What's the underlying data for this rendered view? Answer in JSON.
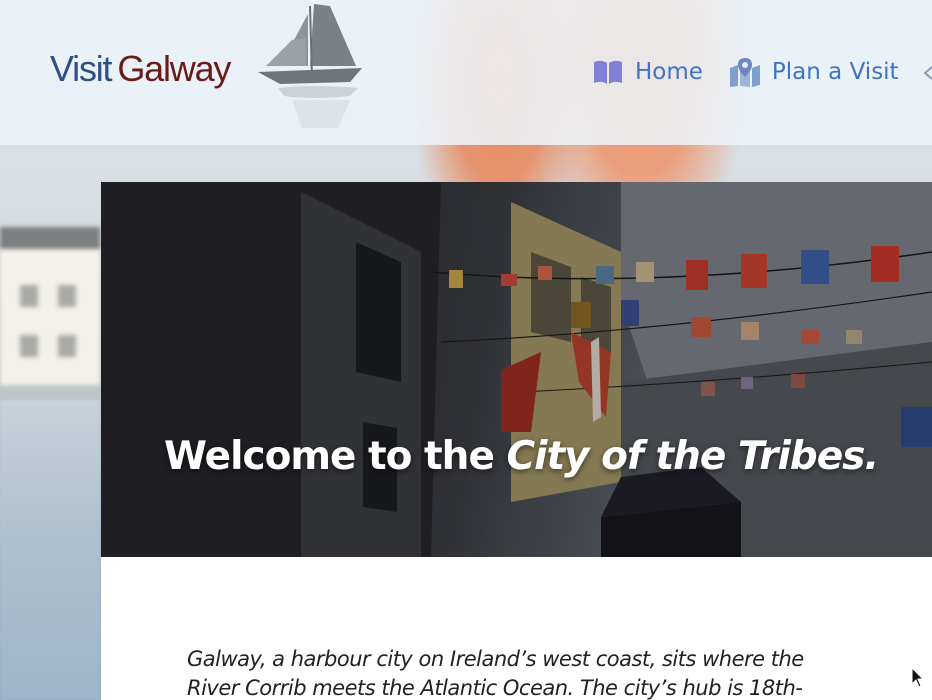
{
  "logo": {
    "visit": "Visit",
    "galway": "Galway",
    "colors": {
      "visit": "#2d4f86",
      "galway": "#6b1a1a"
    }
  },
  "nav": {
    "items": [
      {
        "label": "Home",
        "icon": "book-icon"
      },
      {
        "label": "Plan a Visit",
        "icon": "map-marker-icon"
      }
    ],
    "accent": "#3e73c5"
  },
  "hero": {
    "title_lead": "Welcome to the ",
    "title_emphasis": "City of the Tribes."
  },
  "intro": {
    "text": "Galway, a harbour city on Ireland’s west coast, sits where the River Corrib meets the Atlantic Ocean. The city’s hub is 18th-"
  }
}
